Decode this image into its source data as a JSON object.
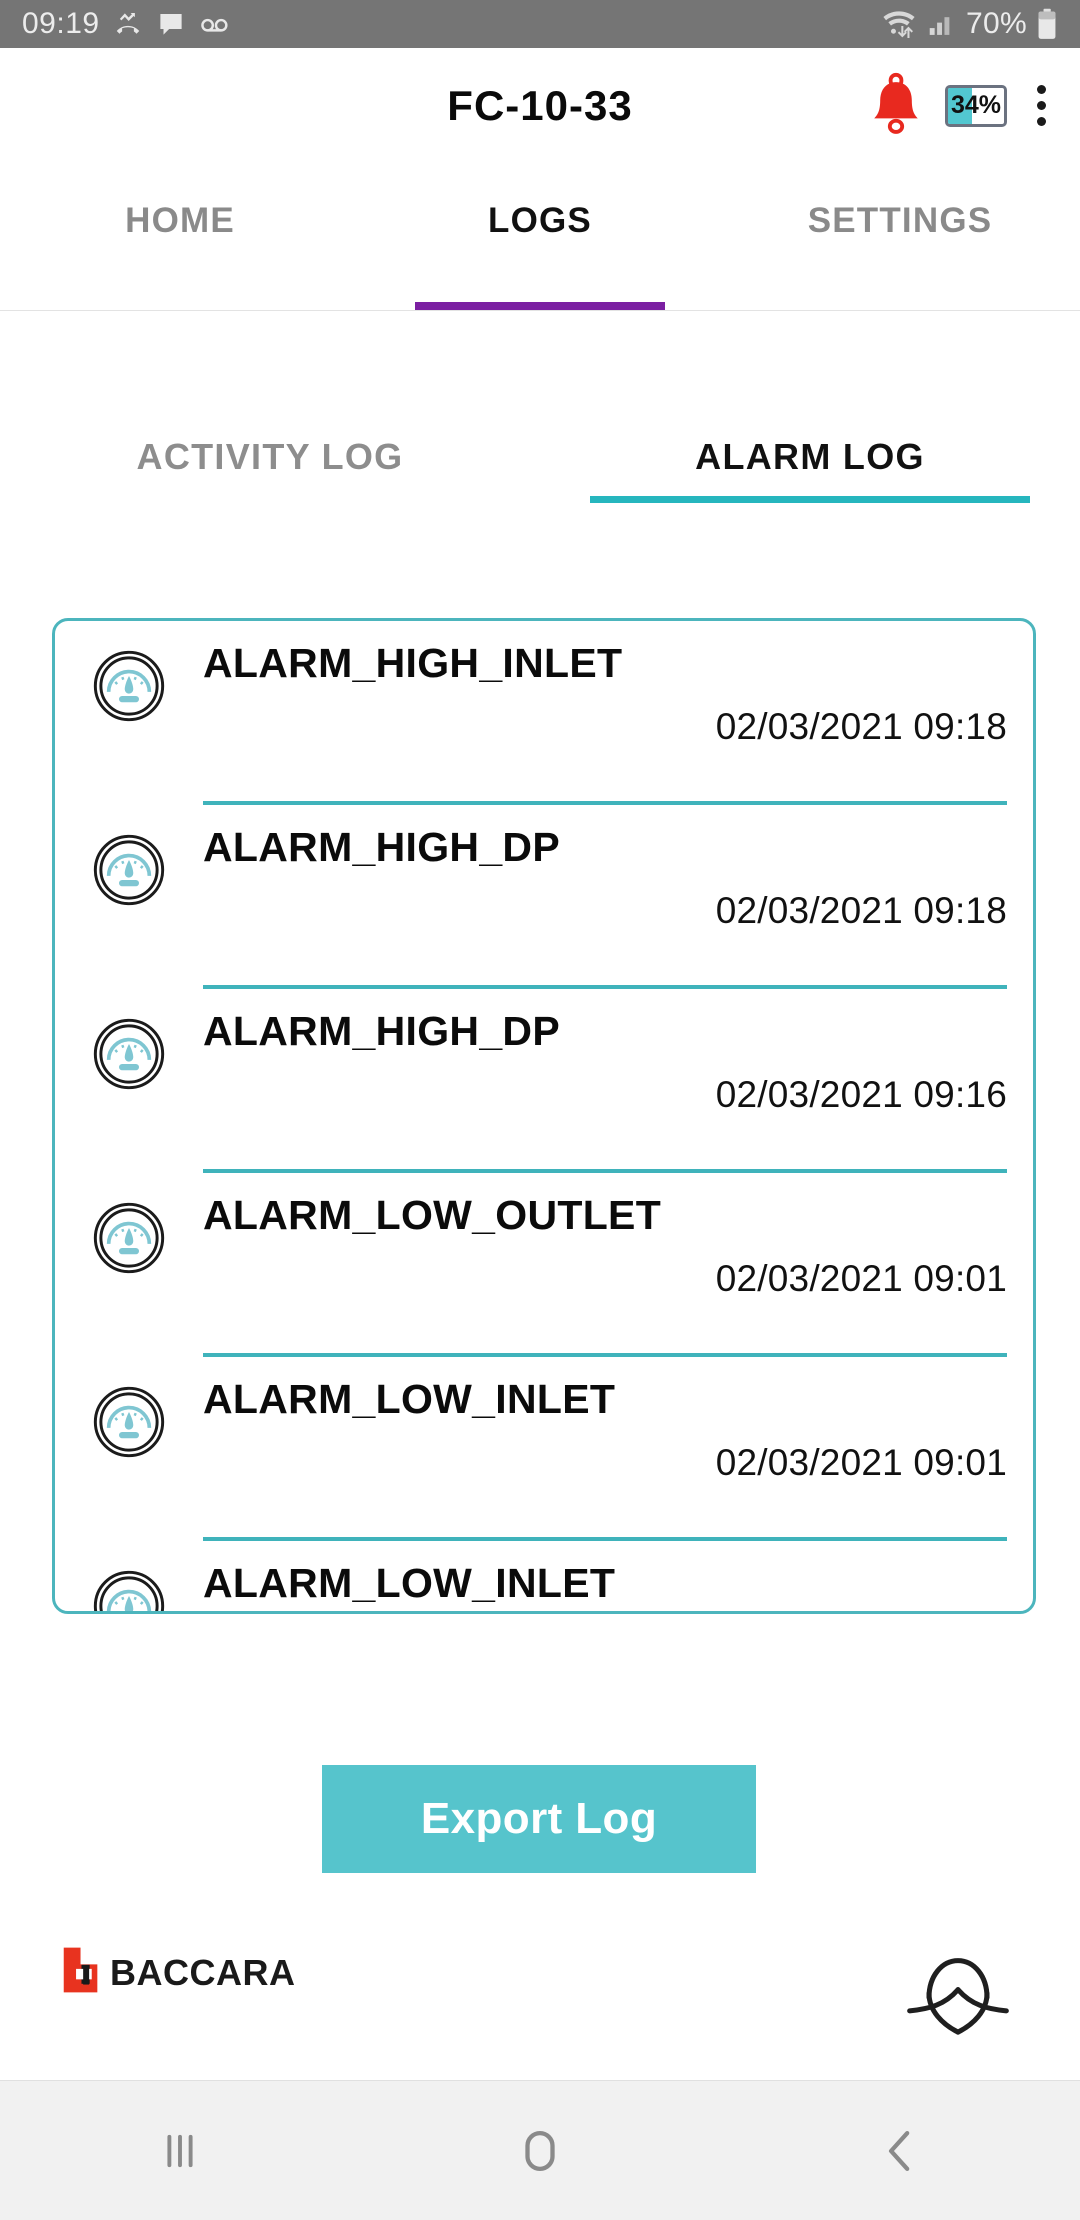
{
  "status_bar": {
    "time": "09:19",
    "battery_percent": "70%",
    "icons": [
      "missed-call-icon",
      "message-icon",
      "voicemail-icon",
      "wifi-icon",
      "cellular-signal-icon",
      "battery-icon"
    ],
    "background_color": "#757575"
  },
  "app_bar": {
    "title": "FC-10-33",
    "alert_bell_color": "#e8291f",
    "device_battery_label": "34%",
    "device_battery_fill_color": "#52c7d0",
    "menu_icon": "kebab-menu-icon"
  },
  "main_tabs": {
    "active_index": 1,
    "indicator_color": "#7B1FA2",
    "items": [
      {
        "label": "HOME"
      },
      {
        "label": "LOGS"
      },
      {
        "label": "SETTINGS"
      }
    ]
  },
  "sub_tabs": {
    "active_index": 1,
    "indicator_color": "#26b6be",
    "items": [
      {
        "label": "ACTIVITY LOG"
      },
      {
        "label": "ALARM LOG"
      }
    ]
  },
  "alarm_log": {
    "border_color": "#4cb5bd",
    "separator_color": "#3fb3bb",
    "row_icon": "pressure-gauge-icon",
    "entries": [
      {
        "name": "ALARM_HIGH_INLET",
        "timestamp": "02/03/2021 09:18"
      },
      {
        "name": "ALARM_HIGH_DP",
        "timestamp": "02/03/2021 09:18"
      },
      {
        "name": "ALARM_HIGH_DP",
        "timestamp": "02/03/2021 09:16"
      },
      {
        "name": "ALARM_LOW_OUTLET",
        "timestamp": "02/03/2021 09:01"
      },
      {
        "name": "ALARM_LOW_INLET",
        "timestamp": "02/03/2021 09:01"
      },
      {
        "name": "ALARM_LOW_INLET",
        "timestamp": ""
      }
    ]
  },
  "export": {
    "label": "Export Log",
    "background_color": "#56c4cc",
    "text_color": "#ffffff"
  },
  "footer": {
    "company_name": "BACCARA",
    "company_mark_color": "#e8331f",
    "secondary_logo": "crossed-loop-logo"
  },
  "nav_bar": {
    "items": [
      {
        "icon": "recents-icon"
      },
      {
        "icon": "home-icon"
      },
      {
        "icon": "back-icon"
      }
    ]
  }
}
